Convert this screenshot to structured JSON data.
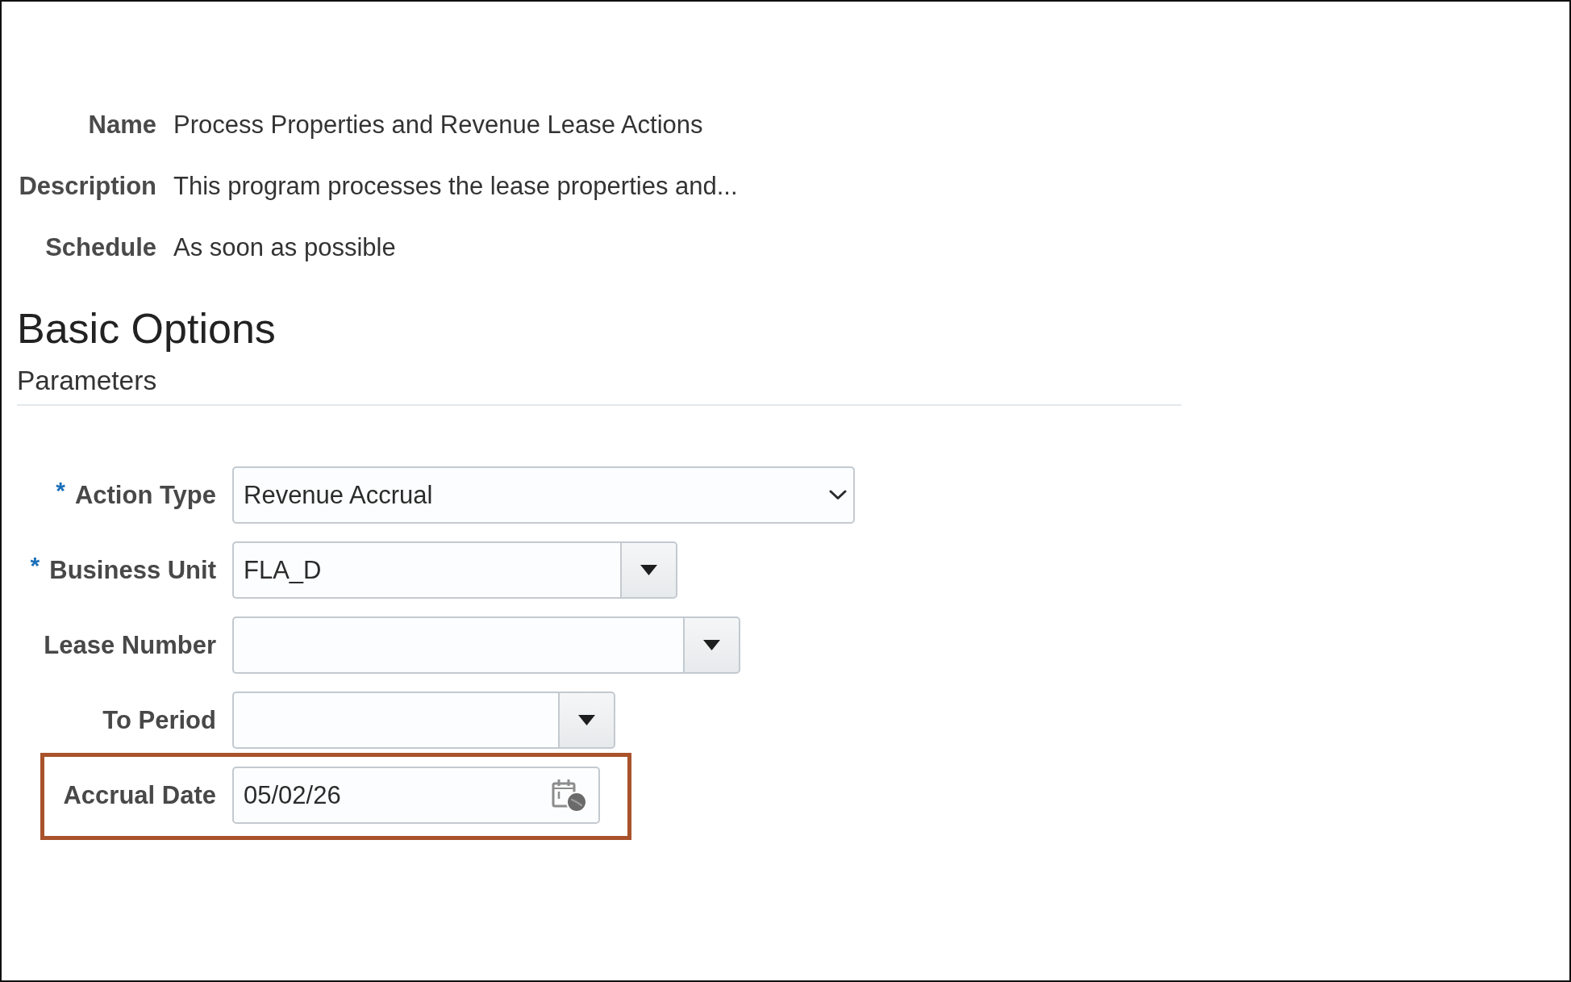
{
  "info": [
    {
      "label": "Name",
      "value": "Process Properties and Revenue Lease Actions"
    },
    {
      "label": "Description",
      "value": "This program processes the lease properties and..."
    },
    {
      "label": "Schedule",
      "value": "As soon as possible"
    }
  ],
  "section": {
    "title": "Basic Options",
    "subtitle": "Parameters"
  },
  "fields": [
    {
      "label": "Action Type",
      "required_mark": "*",
      "kind": "select",
      "value": "Revenue Accrual",
      "highlighted": false
    },
    {
      "label": "Business Unit",
      "required_mark": "*",
      "kind": "combo",
      "value": "FLA_D",
      "highlighted": false
    },
    {
      "label": "Lease Number",
      "kind": "combo",
      "highlighted": false
    },
    {
      "label": "To Period",
      "kind": "combo",
      "highlighted": false
    },
    {
      "label": "Accrual Date",
      "kind": "date",
      "value": "05/02/26",
      "highlighted": true
    }
  ]
}
